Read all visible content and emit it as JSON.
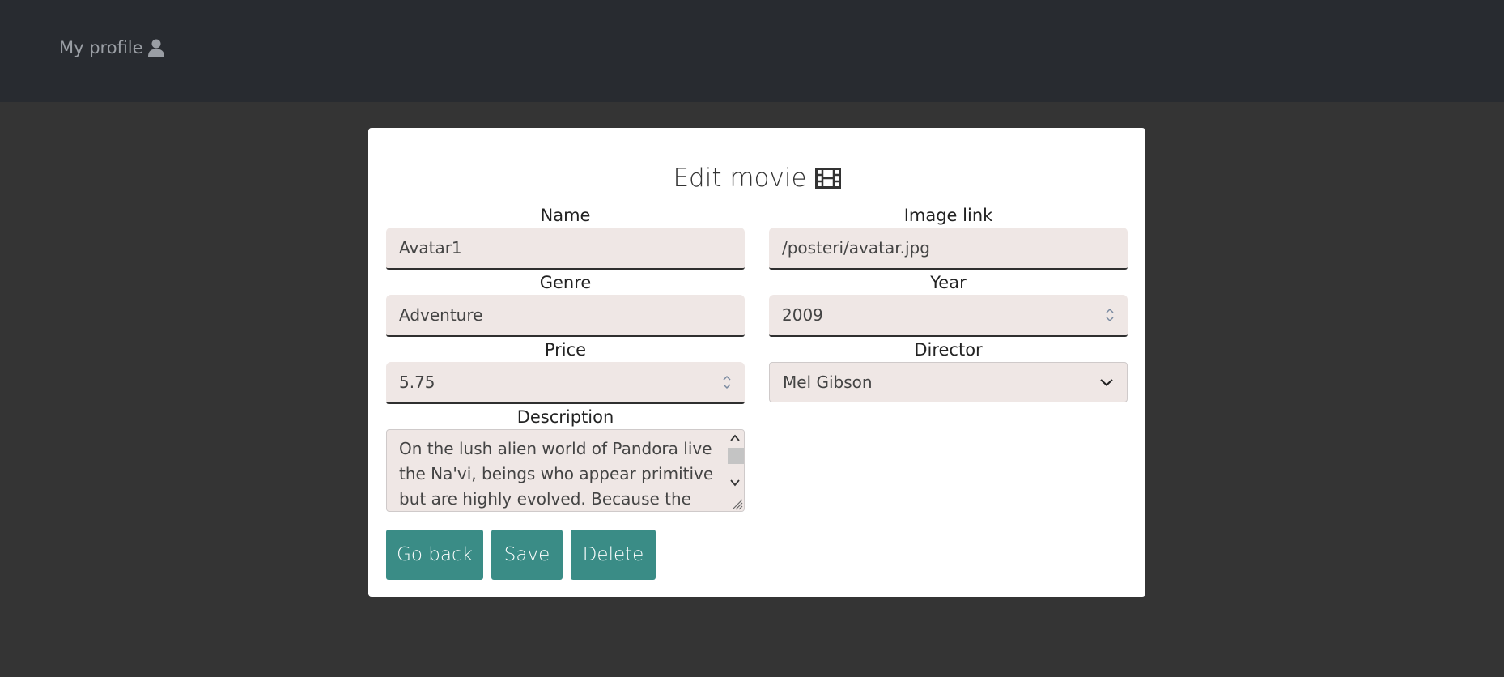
{
  "navbar": {
    "profile_label": "My profile"
  },
  "form": {
    "title": "Edit movie",
    "fields": {
      "name": {
        "label": "Name",
        "value": "Avatar1"
      },
      "image_link": {
        "label": "Image link",
        "value": "/posteri/avatar.jpg"
      },
      "genre": {
        "label": "Genre",
        "value": "Adventure"
      },
      "year": {
        "label": "Year",
        "value": "2009"
      },
      "price": {
        "label": "Price",
        "value": "5.75"
      },
      "director": {
        "label": "Director",
        "value": "Mel Gibson"
      },
      "description": {
        "label": "Description",
        "value": "On the lush alien world of Pandora live the Na'vi, beings who appear primitive but are highly evolved. Because the planet's"
      }
    },
    "buttons": {
      "go_back": "Go back",
      "save": "Save",
      "delete": "Delete"
    }
  },
  "colors": {
    "navbar_bg": "#282b30",
    "page_bg": "#343434",
    "card_bg": "#ffffff",
    "input_bg": "#efe7e5",
    "button_bg": "#3a8c86"
  },
  "icons": {
    "profile": "user-icon",
    "title": "film-icon"
  }
}
